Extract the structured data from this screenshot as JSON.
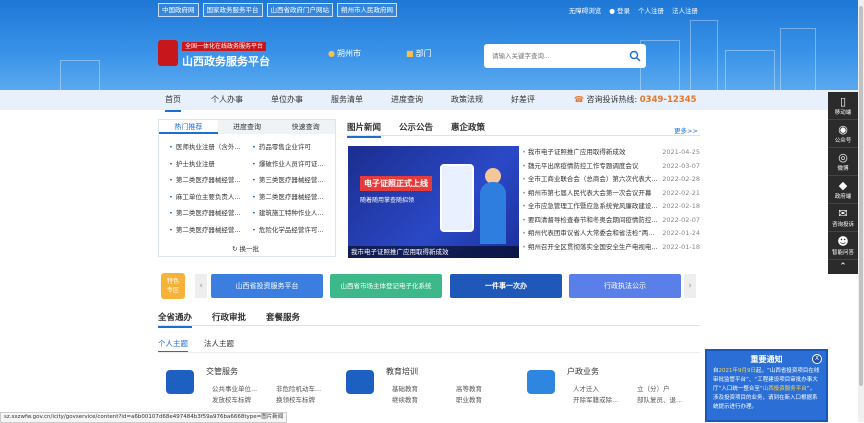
{
  "top_links": [
    "中国政府网",
    "国家政务服务平台",
    "山西省政府门户网站",
    "朔州市人民政府网"
  ],
  "top_right": {
    "accessible": "无障碍浏览",
    "login": "登录",
    "personal_reg": "个人注册",
    "corp_reg": "法人注册"
  },
  "brand": {
    "tagline": "全国一体化在线政务服务平台",
    "title": "山西政务服务平台"
  },
  "location": {
    "city": "朔州市",
    "dept": "部门"
  },
  "search": {
    "placeholder": "请输入关键字查询..."
  },
  "nav": {
    "items": [
      "首页",
      "个人办事",
      "单位办事",
      "服务清单",
      "进度查询",
      "政策法规",
      "好差评"
    ],
    "hotline_label": "咨询投诉热线:",
    "hotline_number": "0349-12345"
  },
  "left_panel": {
    "tabs": [
      "热门推荐",
      "进度查询",
      "快速查询"
    ],
    "items": [
      "医师执业注册（含外...",
      "药品零售企业许可",
      "护士执业注册",
      "爆破作业人员许可证...",
      "第二类医疗器械经营...",
      "第三类医疗器械经营...",
      "麻工单位主要负责人...",
      "第二类医疗器械经营...",
      "第二类医疗器械经营...",
      "建筑施工特种作业人...",
      "第二类医疗器械经营...",
      "危险化学品经营许可..."
    ],
    "more": "换一批"
  },
  "news": {
    "tabs": [
      "图片新闻",
      "公示公告",
      "惠企政策"
    ],
    "more": "更多>>",
    "image": {
      "caption": "我市电子证照推广应用取得新成效",
      "headline": "电子证照正式上线",
      "sub": "随着随用掌查随招领"
    },
    "items": [
      {
        "title": "我市电子证照推广应用取得新成效",
        "date": "2021-04-25"
      },
      {
        "title": "魏元平出席疫情防控工作专题调度会议",
        "date": "2022-03-07"
      },
      {
        "title": "全市工商业联合会（总商会）第六次代表大...",
        "date": "2022-02-28"
      },
      {
        "title": "朔州市第七届人民代表大会第一次会议开幕",
        "date": "2022-02-21"
      },
      {
        "title": "全市应急管理工作暨应急系统党风廉政建设...",
        "date": "2022-02-18"
      },
      {
        "title": "要四清督导检查春节和冬奥会期间疫情防控...",
        "date": "2022-02-07"
      },
      {
        "title": "朔州代表团审议省人大常委会和省法检“两...",
        "date": "2022-01-24"
      },
      {
        "title": "朔州召开全区贯彻落实全国安全生产电视电...",
        "date": "2022-01-18"
      }
    ]
  },
  "banner": {
    "tag": [
      "特色",
      "专区"
    ],
    "cards": [
      {
        "label": "山西省投资服务平台",
        "color": "#3c7ee0"
      },
      {
        "label": "山西省市场主体登记电子化系统",
        "color": "#3cb88a"
      },
      {
        "label": "一件事一次办",
        "color": "#1f58b8"
      },
      {
        "label": "行政执法公示",
        "color": "#5b7fe8"
      }
    ]
  },
  "bottom_tabs": [
    "全省通办",
    "行政审批",
    "套餐服务"
  ],
  "sub_tabs": [
    "个人主题",
    "法人主题"
  ],
  "services": [
    {
      "title": "交管服务",
      "items": [
        "公共事业单位...",
        "非危险机动车...",
        "发放校车标牌",
        "换领校车标牌"
      ]
    },
    {
      "title": "教育培训",
      "items": [
        "基础教育",
        "高等教育",
        "继续教育",
        "职业教育"
      ]
    },
    {
      "title": "户政业务",
      "items": [
        "人才迁入",
        "立（分）户",
        "开除军籍或除...",
        "部队复员、退..."
      ]
    }
  ],
  "sidebar": [
    "移动端",
    "公众号",
    "微博",
    "政府端",
    "咨询投诉",
    "智能问答"
  ],
  "notice": {
    "title": "重要通知",
    "close": "X",
    "body_parts": [
      "自",
      "2021年9月9日",
      "起，“山西省投资项目在线审批监管平台”、“工程建设项目审批办事大厅”入口统一整合至“",
      "山西投资服务平台",
      "”，涉及投资项目的业务，请到在新入口根据系统提示进行办理。"
    ]
  },
  "status_url": "sz.sxzwfw.gov.cn/icity/govservice/content?id=a6b00107d68e497484b3f59a976ba6668type=图片新闻"
}
